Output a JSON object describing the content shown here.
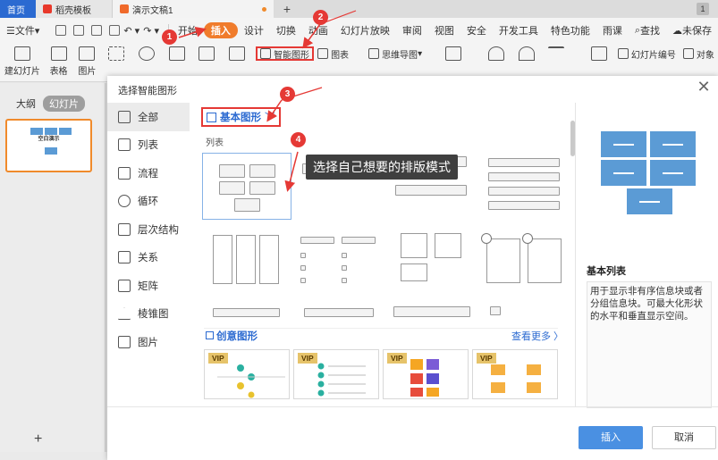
{
  "tabs": [
    {
      "label": "首页"
    },
    {
      "label": "稻壳模板"
    },
    {
      "label": "演示文稿1"
    }
  ],
  "window_badge": "1",
  "menu": {
    "file": "文件",
    "items": [
      "开始",
      "插入",
      "设计",
      "切换",
      "动画",
      "幻灯片放映",
      "审阅",
      "视图",
      "安全",
      "开发工具",
      "特色功能",
      "雨课"
    ],
    "search": "查找",
    "unsaved": "未保存"
  },
  "ribbon": {
    "new_slide": "建幻灯片",
    "table": "表格",
    "picture": "图片",
    "smartart": "智能图形",
    "chart": "图表",
    "mindmap": "思维导图",
    "slide_number": "幻灯片编号",
    "object": "对象"
  },
  "left_panel": {
    "tab_outline": "大纲",
    "tab_slides": "幻灯片",
    "thumb_title": "空白演示"
  },
  "dialog": {
    "title": "选择智能图形",
    "categories": [
      "全部",
      "列表",
      "流程",
      "循环",
      "层次结构",
      "关系",
      "矩阵",
      "棱锥图",
      "图片"
    ],
    "top_category": "基本图形",
    "section_list": "列表",
    "callout": "选择自己想要的排版模式",
    "creative_title": "创意图形",
    "see_more": "查看更多",
    "vip": "VIP",
    "preview_name": "基本列表",
    "preview_desc": "用于显示非有序信息块或者分组信息块。可最大化形状的水平和垂直显示空间。",
    "insert": "插入",
    "cancel": "取消"
  },
  "annotations": [
    "1",
    "2",
    "3",
    "4"
  ],
  "colors": {
    "accent_orange": "#f07c2c",
    "annotation_red": "#e53935",
    "link_blue": "#2b6ad1",
    "preview_blue": "#5b9bd5",
    "insert_blue": "#4a90e2"
  }
}
